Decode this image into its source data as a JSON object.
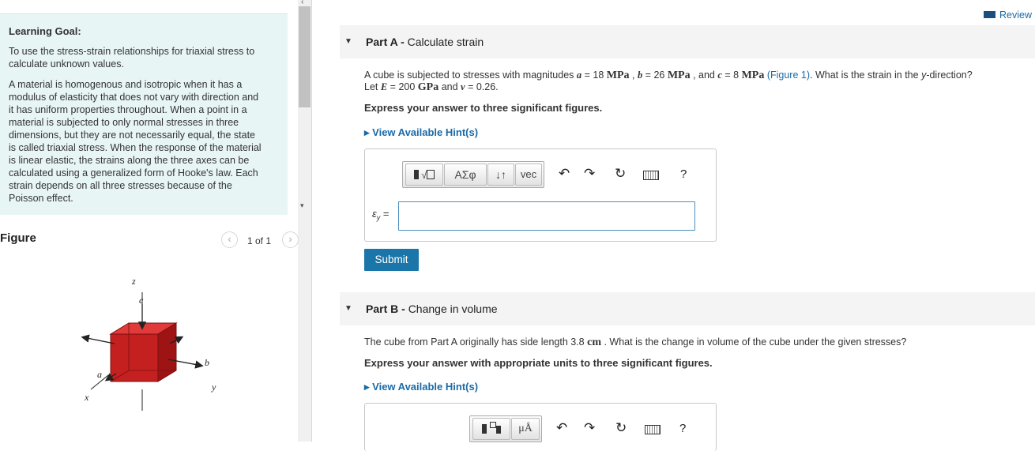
{
  "left_panel": {
    "goal_title": "Learning Goal:",
    "goal_p1_l1": "To use the stress-strain relationships for triaxial stress to",
    "goal_p1_l2": "calculate unknown values.",
    "goal_p2_lines": [
      "A material is homogenous and isotropic when it has a",
      "modulus of elasticity that does not vary with direction and",
      "it has uniform properties throughout. When a point in a",
      "material is subjected to only normal stresses in three",
      "dimensions, but they are not necessarily equal, the state",
      "is called triaxial stress. When the response of the material",
      "is linear elastic, the strains along the three axes can be",
      "calculated using a generalized form of Hooke's law. Each",
      "strain depends on all three stresses because of the",
      "Poisson effect."
    ],
    "figure_label": "Figure",
    "pager_text": "1 of 1",
    "prev_icon": "chevron-left-icon",
    "next_icon": "chevron-right-icon",
    "cube_labels": {
      "z": "z",
      "c": "c",
      "b": "b",
      "y": "y",
      "a": "a",
      "x": "x"
    }
  },
  "review": {
    "label": "Review",
    "icon": "review-icon"
  },
  "part_a": {
    "prefix": "Part A",
    "title": "Calculate strain",
    "q_l1_a": "A cube is subjected to stresses with magnitudes ",
    "q_a_var": "a",
    "q_a_val": " = 18 ",
    "q_unit_mpa": "MPa",
    "q_comma1": " , ",
    "q_b_var": "b",
    "q_b_val": " = 26 ",
    "q_and_c": " , and ",
    "q_c_var": "c",
    "q_c_val": " = 8 ",
    "q_space": " ",
    "q_figure_link": "(Figure 1)",
    "q_l1_end": ". What is the strain in the ",
    "q_y": "y",
    "q_l1_tail": "-direction?",
    "q_l2_let": "Let ",
    "q_E": "E",
    "q_E_val": " = 200 ",
    "q_unit_gpa": "GPa",
    "q_and_nu": " and ",
    "q_nu": "ν",
    "q_nu_val": " = 0.26.",
    "instruction": "Express your answer to three significant figures.",
    "hint": "View Available Hint(s)",
    "answer_label": "ε",
    "answer_sub": "y",
    "answer_eq": " =",
    "answer_value": "",
    "toolbar": {
      "templates_icon": "fraction-sqrt-icon",
      "greek_label": "ΑΣφ",
      "arrows_label": "↓↑",
      "vec_label": "vec",
      "undo_icon": "undo-icon",
      "redo_icon": "redo-icon",
      "reset_icon": "reset-icon",
      "keyboard_icon": "keyboard-icon",
      "help_label": "?"
    },
    "submit": "Submit"
  },
  "part_b": {
    "prefix": "Part B",
    "title": "Change in volume",
    "q_text": "The cube from Part A originally has side length 3.8 ",
    "q_unit_cm": "cm",
    "q_tail": " . What is the change in volume of the cube under the given stresses?",
    "instruction": "Express your answer with appropriate units to three significant figures.",
    "hint": "View Available Hint(s)",
    "toolbar": {
      "templates_icon": "units-template-icon",
      "units_label": "μÅ",
      "help_label": "?"
    }
  }
}
